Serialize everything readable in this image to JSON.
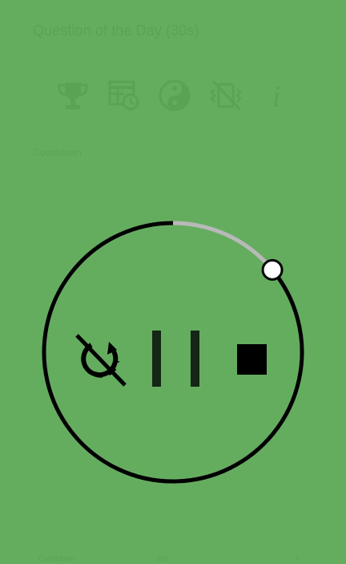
{
  "header": {
    "title": "Question of the Day (30s)"
  },
  "toolbar": {
    "icons": [
      {
        "name": "trophy-icon"
      },
      {
        "name": "schedule-table-icon"
      },
      {
        "name": "yin-yang-icon"
      },
      {
        "name": "vibration-off-icon"
      },
      {
        "name": "info-icon"
      }
    ]
  },
  "content": {
    "subtitle": "Countdown"
  },
  "timer": {
    "progress": 0.86,
    "colors": {
      "progress": "#000000",
      "track": "#b9b9b9",
      "knob": "#ffffff",
      "background": "#64ad5f",
      "faint_text": "#5aa355"
    }
  },
  "controls": {
    "repeat_off": "repeat-off-icon",
    "pause": "pause-icon",
    "stop": "stop-icon"
  },
  "footer": {
    "left": "Countdown",
    "middle": "30s",
    "right": "≡"
  }
}
